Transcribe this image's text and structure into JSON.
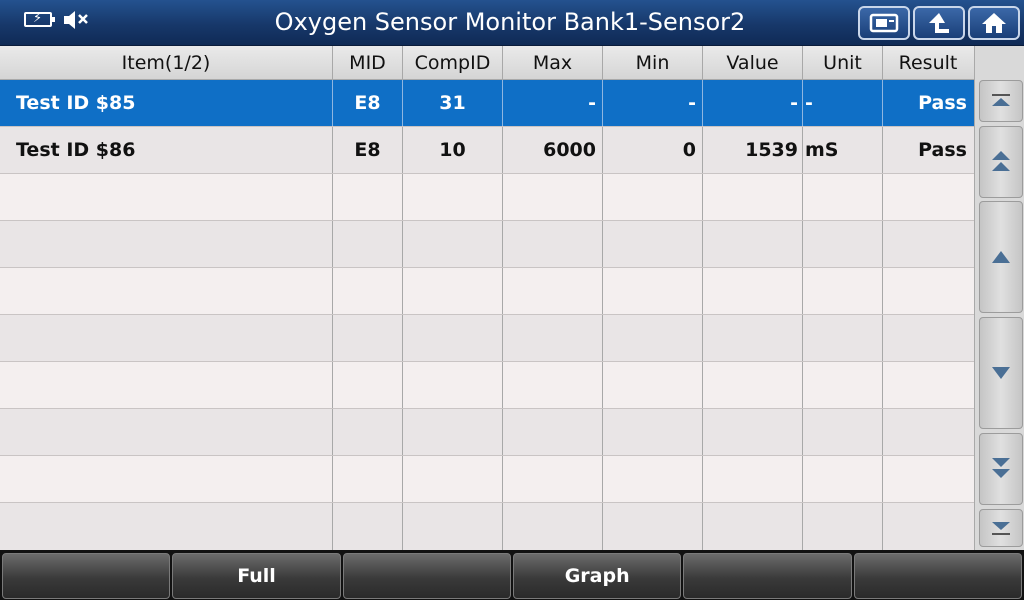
{
  "header": {
    "title": "Oxygen Sensor Monitor Bank1-Sensor2",
    "icons": [
      "battery-icon",
      "mute-speaker-icon",
      "screenshot-icon",
      "back-arrow-icon",
      "home-icon"
    ]
  },
  "table": {
    "columns": {
      "item": "Item(1/2)",
      "mid": "MID",
      "comp": "CompID",
      "max": "Max",
      "min": "Min",
      "value": "Value",
      "unit": "Unit",
      "result": "Result"
    },
    "rows": [
      {
        "item": "Test ID $85",
        "mid": "E8",
        "comp": "31",
        "max": "-",
        "min": "-",
        "value": "-",
        "unit": "-",
        "result": "Pass",
        "selected": true
      },
      {
        "item": "Test ID $86",
        "mid": "E8",
        "comp": "10",
        "max": "6000",
        "min": "0",
        "value": "1539",
        "unit": "mS",
        "result": "Pass",
        "selected": false
      }
    ]
  },
  "scrollbar": {
    "buttons": [
      "scroll-top-icon",
      "page-up-icon",
      "line-up-icon",
      "line-down-icon",
      "page-down-icon",
      "scroll-bottom-icon"
    ]
  },
  "footer": {
    "buttons": [
      "",
      "Full",
      "",
      "Graph",
      "",
      ""
    ]
  },
  "colors": {
    "title_bar": "#1a3f78",
    "selected_row": "#0f6fc6",
    "row_light": "#f4efef",
    "row_alt": "#e9e5e6"
  }
}
